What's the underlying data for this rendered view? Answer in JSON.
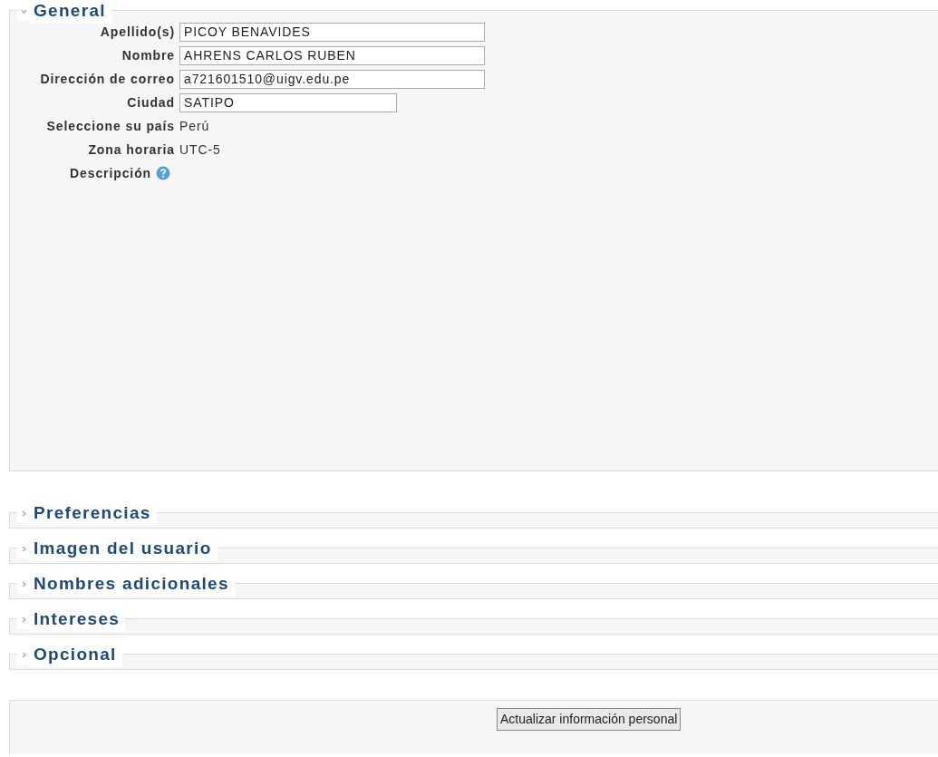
{
  "sections": [
    {
      "title": "General",
      "expanded": true,
      "fields": [
        {
          "kind": "input",
          "label": "Apellido(s)",
          "value": "PICOY BENAVIDES"
        },
        {
          "kind": "input",
          "label": "Nombre",
          "value": "AHRENS CARLOS RUBEN"
        },
        {
          "kind": "input",
          "label": "Dirección de correo",
          "value": "a721601510@uigv.edu.pe"
        },
        {
          "kind": "short_input",
          "label": "Ciudad",
          "value": "SATIPO"
        },
        {
          "kind": "static",
          "label": "Seleccione su país",
          "value": "Perú"
        },
        {
          "kind": "static",
          "label": "Zona horaria",
          "value": "UTC-5"
        },
        {
          "kind": "help",
          "label": "Descripción"
        }
      ]
    },
    {
      "title": "Preferencias",
      "expanded": false
    },
    {
      "title": "Imagen del usuario",
      "expanded": false
    },
    {
      "title": "Nombres adicionales",
      "expanded": false
    },
    {
      "title": "Intereses",
      "expanded": false
    },
    {
      "title": "Opcional",
      "expanded": false
    }
  ],
  "submit": {
    "label": "Actualizar información personal"
  }
}
